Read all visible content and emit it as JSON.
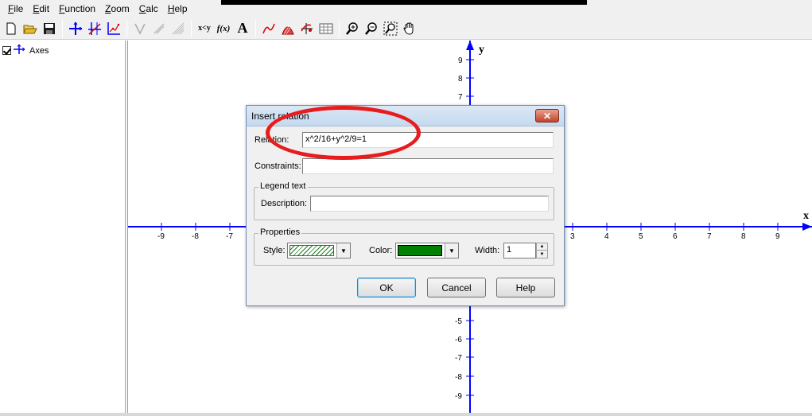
{
  "menu": [
    "File",
    "Edit",
    "Function",
    "Zoom",
    "Calc",
    "Help"
  ],
  "toolbar": {
    "buttons": [
      "new-icon",
      "open-icon",
      "save-icon",
      "axes-icon",
      "function-axes-icon",
      "point-series-icon",
      "tangent-icon",
      "normal-icon",
      "shade-icon",
      "insert-relation-text",
      "insert-function-text",
      "text-label-icon",
      "trendline-icon",
      "shading-icon",
      "relation-icon",
      "table-icon",
      "zoom-in-icon",
      "zoom-out-icon",
      "zoom-window-icon",
      "pan-hand-icon"
    ],
    "relation_label": "x<y",
    "function_label": "f(x)",
    "text_label": "A"
  },
  "tree": {
    "item_label": "Axes",
    "checked": true
  },
  "graph": {
    "x_axis_name": "x",
    "y_axis_name": "y",
    "x_ticks_neg": [
      "-9",
      "-8",
      "-7"
    ],
    "x_ticks_pos": [
      "3",
      "4",
      "5",
      "6",
      "7",
      "8",
      "9"
    ],
    "y_ticks_pos_top": [
      "9",
      "8",
      "7"
    ],
    "y_ticks_neg_bottom": [
      "-5",
      "-6",
      "-7",
      "-8",
      "-9"
    ],
    "axis_color": "#0000ff"
  },
  "dialog": {
    "title": "Insert relation",
    "relation_label": "Relation:",
    "relation_value": "x^2/16+y^2/9=1",
    "constraints_label": "Constraints:",
    "constraints_value": "",
    "legend_group": "Legend text",
    "description_label": "Description:",
    "description_value": "",
    "properties_group": "Properties",
    "style_label": "Style:",
    "color_label": "Color:",
    "color_value": "#008000",
    "width_label": "Width:",
    "width_value": "1",
    "ok_label": "OK",
    "cancel_label": "Cancel",
    "help_label": "Help",
    "close_glyph": "✕"
  },
  "annotation_color": "#e81c1c"
}
